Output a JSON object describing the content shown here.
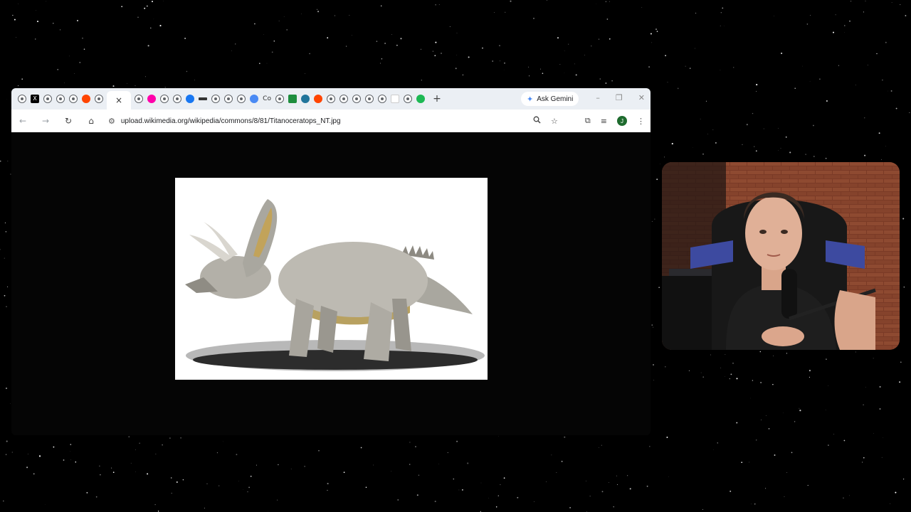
{
  "background": {
    "color": "#000000"
  },
  "browser": {
    "tabs_icons": [
      "tab-icon",
      "x-icon",
      "tab-icon",
      "tab-icon",
      "tab-icon",
      "reddit-icon",
      "tab-icon"
    ],
    "active_tab_close": "×",
    "tabs_after": [
      "tab-icon",
      "warning-icon",
      "tab-icon",
      "tab-icon",
      "facebook-icon",
      "bar-icon",
      "tab-icon",
      "tab-icon",
      "tab-icon",
      "chrome-icon",
      "co-icon",
      "tab-icon",
      "green-icon",
      "wordpress-icon",
      "reddit-icon",
      "tab-icon",
      "tab-icon",
      "tab-icon",
      "tab-icon",
      "tab-icon",
      "white-icon",
      "gray-icon",
      "spotify-icon"
    ],
    "co_label": "Co",
    "new_tab": "+",
    "ask_gemini": "Ask Gemini",
    "window_controls": {
      "minimize": "–",
      "restore": "❐",
      "close": "✕"
    },
    "nav": {
      "back": "←",
      "forward": "→",
      "reload": "↻",
      "home": "⌂"
    },
    "url": "upload.wikimedia.org/wikipedia/commons/8/81/Titanoceratops_NT.jpg",
    "toolbar_icons": {
      "zoom": "🔍",
      "bookmark": "☆",
      "tab_search": "⧉",
      "media": "≡",
      "menu": "⋮"
    },
    "avatar_letter": "J"
  },
  "content": {
    "image": {
      "subject": "Titanoceratops illustration",
      "background": "#ffffff"
    }
  },
  "webcam": {
    "subject": "streamer"
  }
}
